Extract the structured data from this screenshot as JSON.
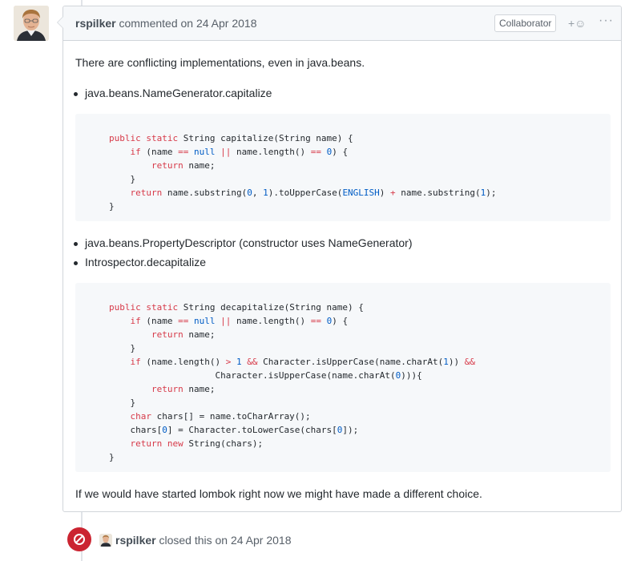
{
  "comment": {
    "author": "rspilker",
    "action": "commented on",
    "date": "24 Apr 2018",
    "badge": "Collaborator",
    "reaction_symbol": "+☺",
    "more_symbol": "···",
    "intro": "There are conflicting implementations, even in java.beans.",
    "bullet1": "java.beans.NameGenerator.capitalize",
    "code1": [
      "public static String capitalize(String name) {",
      "    if (name == null || name.length() == 0) {",
      "        return name;",
      "    }",
      "    return name.substring(0, 1).toUpperCase(ENGLISH) + name.substring(1);",
      "}"
    ],
    "bullet2": "java.beans.PropertyDescriptor (constructor uses NameGenerator)",
    "bullet3": "Introspector.decapitalize",
    "code2": [
      "public static String decapitalize(String name) {",
      "    if (name == null || name.length() == 0) {",
      "        return name;",
      "    }",
      "    if (name.length() > 1 && Character.isUpperCase(name.charAt(1)) &&",
      "                    Character.isUpperCase(name.charAt(0))){",
      "        return name;",
      "    }",
      "    char chars[] = name.toCharArray();",
      "    chars[0] = Character.toLowerCase(chars[0]);",
      "    return new String(chars);",
      "}"
    ],
    "outro": "If we would have started lombok right now we might have made a different choice."
  },
  "event": {
    "author": "rspilker",
    "action": "closed this on",
    "date": "24 Apr 2018",
    "icon": "closed-icon"
  },
  "colors": {
    "closed": "#cb2431",
    "keyword": "#d73a49",
    "constant": "#005cc5"
  }
}
